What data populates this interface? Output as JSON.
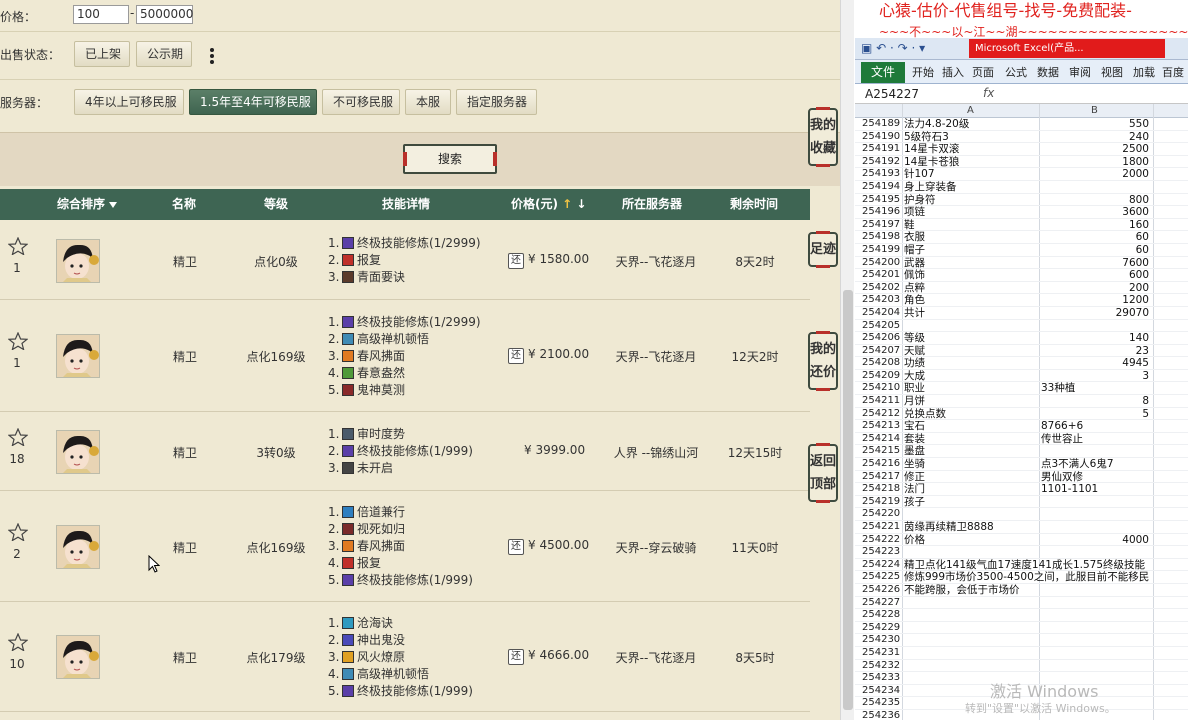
{
  "filters": {
    "price_label": "价格：",
    "price_min": "100",
    "price_max": "5000000",
    "price_sep": "-",
    "status_label": "出售状态：",
    "status_options": [
      "已上架",
      "公示期"
    ],
    "server_label": "服务器：",
    "server_options": [
      "4年以上可移民服",
      "1.5年至4年可移民服",
      "不可移民服",
      "本服",
      "指定服务器"
    ],
    "active_server": "1.5年至4年可移民服",
    "search_label": "搜索"
  },
  "table": {
    "headers": {
      "sort": "综合排序",
      "name": "名称",
      "level": "等级",
      "skills": "技能详情",
      "price": "价格(元)",
      "server": "所在服务器",
      "remain": "剩余时间"
    },
    "rows": [
      {
        "rank": "1",
        "name": "精卫",
        "level": "点化0级",
        "skills": [
          "终极技能修炼(1/2999)",
          "报复",
          "青面要诀"
        ],
        "skill_colors": [
          "#5a3fa8",
          "#c0302a",
          "#5b3a2a"
        ],
        "price": "¥ 1580.00",
        "has_tag": true,
        "server": "天界--飞花逐月",
        "remain": "8天2时"
      },
      {
        "rank": "1",
        "name": "精卫",
        "level": "点化169级",
        "skills": [
          "终极技能修炼(1/2999)",
          "高级禅机顿悟",
          "春风拂面",
          "春意盎然",
          "鬼神莫测"
        ],
        "skill_colors": [
          "#5a3fa8",
          "#3f8bb5",
          "#e07a22",
          "#4f9a3a",
          "#8a2a2a"
        ],
        "price": "¥ 2100.00",
        "has_tag": true,
        "server": "天界--飞花逐月",
        "remain": "12天2时"
      },
      {
        "rank": "18",
        "name": "精卫",
        "level": "3转0级",
        "skills": [
          "审时度势",
          "终极技能修炼(1/999)",
          "未开启"
        ],
        "skill_colors": [
          "#4a5a6a",
          "#5a3fa8",
          "#444444"
        ],
        "price": "¥ 3999.00",
        "has_tag": false,
        "server": "人界 --锦绣山河",
        "remain": "12天15时"
      },
      {
        "rank": "2",
        "name": "精卫",
        "level": "点化169级",
        "skills": [
          "倍道兼行",
          "视死如归",
          "春风拂面",
          "报复",
          "终极技能修炼(1/999)"
        ],
        "skill_colors": [
          "#2f7fc0",
          "#7a2a2a",
          "#e07a22",
          "#c0302a",
          "#5a3fa8"
        ],
        "price": "¥ 4500.00",
        "has_tag": true,
        "server": "天界--穿云破骑",
        "remain": "11天0时"
      },
      {
        "rank": "10",
        "name": "精卫",
        "level": "点化179级",
        "skills": [
          "沧海诀",
          "神出鬼没",
          "风火燎原",
          "高级禅机顿悟",
          "终极技能修炼(1/999)"
        ],
        "skill_colors": [
          "#2f9ac0",
          "#4a4ab8",
          "#e0a022",
          "#3f8bb5",
          "#5a3fa8"
        ],
        "price": "¥ 4666.00",
        "has_tag": true,
        "server": "天界--飞花逐月",
        "remain": "8天5时"
      }
    ]
  },
  "side_tabs": [
    "我的收藏",
    "足迹",
    "我的还价",
    "返回顶部"
  ],
  "excel": {
    "overlay_title": "心猿-估价-代售组号-找号-免费配装-",
    "overlay_sub": "~~~不~~~以~江~~湖~~~~~~~~~~~~~~~~~~~~~~~~~~~~~~",
    "window_title": "Microsoft Excel(产品...",
    "qat": "▣ ↶ · ↷ · ▾",
    "tabs": [
      "文件",
      "开始",
      "插入",
      "页面",
      "公式",
      "数据",
      "审阅",
      "视图",
      "加载",
      "百度"
    ],
    "name_box": "A254227",
    "fx": "fx",
    "col_a": "A",
    "col_b": "B",
    "rows": [
      {
        "n": "254189",
        "a": "法力4.8-20级",
        "b": "550"
      },
      {
        "n": "254190",
        "a": "5级符石3",
        "b": "240"
      },
      {
        "n": "254191",
        "a": "14星卡双滚",
        "b": "2500"
      },
      {
        "n": "254192",
        "a": "14星卡苍狼",
        "b": "1800"
      },
      {
        "n": "254193",
        "a": "针107",
        "b": "2000"
      },
      {
        "n": "254194",
        "a": "身上穿装备",
        "b": ""
      },
      {
        "n": "254195",
        "a": "护身符",
        "b": "800"
      },
      {
        "n": "254196",
        "a": "项链",
        "b": "3600"
      },
      {
        "n": "254197",
        "a": "鞋",
        "b": "160"
      },
      {
        "n": "254198",
        "a": "衣服",
        "b": "60"
      },
      {
        "n": "254199",
        "a": "帽子",
        "b": "60"
      },
      {
        "n": "254200",
        "a": "武器",
        "b": "7600"
      },
      {
        "n": "254201",
        "a": "佩饰",
        "b": "600"
      },
      {
        "n": "254202",
        "a": "点粹",
        "b": "200"
      },
      {
        "n": "254203",
        "a": "角色",
        "b": "1200"
      },
      {
        "n": "254204",
        "a": "共计",
        "b": "29070"
      },
      {
        "n": "254205",
        "a": "",
        "b": ""
      },
      {
        "n": "254206",
        "a": "等级",
        "b": "140"
      },
      {
        "n": "254207",
        "a": "天赋",
        "b": "23"
      },
      {
        "n": "254208",
        "a": "功绩",
        "b": "4945"
      },
      {
        "n": "254209",
        "a": "大成",
        "b": "3"
      },
      {
        "n": "254210",
        "a": "职业",
        "bl": "33种植"
      },
      {
        "n": "254211",
        "a": "月饼",
        "b": "8"
      },
      {
        "n": "254212",
        "a": "兑换点数",
        "b": "5"
      },
      {
        "n": "254213",
        "a": "宝石",
        "bl": "8766+6"
      },
      {
        "n": "254214",
        "a": "套装",
        "bl": "传世容止"
      },
      {
        "n": "254215",
        "a": "墨盘",
        "b": ""
      },
      {
        "n": "254216",
        "a": "坐骑",
        "bl": "点3不满人6鬼7"
      },
      {
        "n": "254217",
        "a": "修正",
        "bl": "男仙双修"
      },
      {
        "n": "254218",
        "a": "法门",
        "bl": "1101-1101"
      },
      {
        "n": "254219",
        "a": "孩子",
        "b": ""
      },
      {
        "n": "254220",
        "a": "",
        "b": ""
      },
      {
        "n": "254221",
        "a": "茵缘再续精卫8888",
        "b": ""
      },
      {
        "n": "254222",
        "a": "价格",
        "b": "4000"
      },
      {
        "n": "254223",
        "a": "",
        "b": ""
      },
      {
        "n": "254224",
        "span": "精卫点化141级气血17速度141成长1.575终级技能"
      },
      {
        "n": "254225",
        "span": "修炼999市场价3500-4500之间，此服目前不能移民"
      },
      {
        "n": "254226",
        "span": "不能跨服，会低于市场价"
      },
      {
        "n": "254227",
        "a": "",
        "b": ""
      },
      {
        "n": "254228",
        "a": "",
        "b": ""
      },
      {
        "n": "254229",
        "a": "",
        "b": ""
      },
      {
        "n": "254230",
        "a": "",
        "b": ""
      },
      {
        "n": "254231",
        "a": "",
        "b": ""
      },
      {
        "n": "254232",
        "a": "",
        "b": ""
      },
      {
        "n": "254233",
        "a": "",
        "b": ""
      },
      {
        "n": "254234",
        "a": "",
        "b": ""
      },
      {
        "n": "254235",
        "a": "",
        "b": ""
      },
      {
        "n": "254236",
        "a": "",
        "b": ""
      }
    ]
  },
  "watermark": "激活 Windows",
  "watermark_sub": "转到\"设置\"以激活 Windows。"
}
